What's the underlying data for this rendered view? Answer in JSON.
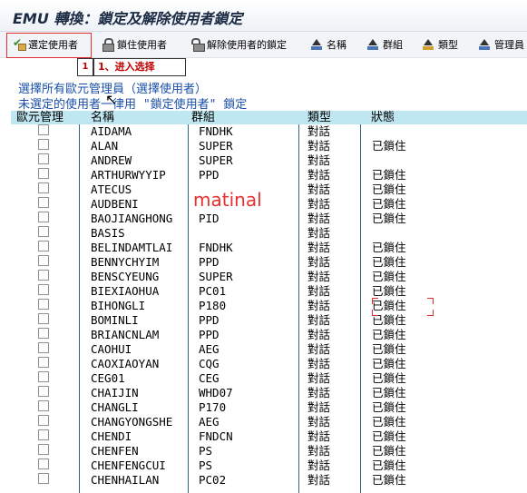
{
  "window": {
    "title": "EMU 轉換：鎖定及解除使用者鎖定"
  },
  "toolbar": {
    "select_users": "選定使用者",
    "lock_users": "鎖住使用者",
    "unlock_users": "解除使用者的鎖定",
    "name": "名稱",
    "group": "群組",
    "type": "類型",
    "admin": "管理員"
  },
  "callout": {
    "number": "1",
    "text": "1、进入选择"
  },
  "links": {
    "select_all_admins": "選擇所有歐元管理員（選擇使用者）",
    "unselected_lock": "未選定的使用者一律用 \"鎖定使用者\" 鎖定"
  },
  "watermark": "matinal",
  "table": {
    "headers": {
      "admin": "歐元管理",
      "name": "名稱",
      "group": "群組",
      "type": "類型",
      "status": "狀態"
    },
    "rows": [
      {
        "name": "AIDAMA",
        "group": "FNDHK",
        "type": "對話",
        "status": ""
      },
      {
        "name": "ALAN",
        "group": "SUPER",
        "type": "對話",
        "status": "已鎖住"
      },
      {
        "name": "ANDREW",
        "group": "SUPER",
        "type": "對話",
        "status": ""
      },
      {
        "name": "ARTHURWYYIP",
        "group": "PPD",
        "type": "對話",
        "status": "已鎖住"
      },
      {
        "name": "ATECUS",
        "group": "",
        "type": "對話",
        "status": "已鎖住"
      },
      {
        "name": "AUDBENI",
        "group": "",
        "type": "對話",
        "status": "已鎖住"
      },
      {
        "name": "BAOJIANGHONG",
        "group": "PID",
        "type": "對話",
        "status": "已鎖住"
      },
      {
        "name": "BASIS",
        "group": "",
        "type": "對話",
        "status": ""
      },
      {
        "name": "BELINDAMTLAI",
        "group": "FNDHK",
        "type": "對話",
        "status": "已鎖住"
      },
      {
        "name": "BENNYCHYIM",
        "group": "PPD",
        "type": "對話",
        "status": "已鎖住"
      },
      {
        "name": "BENSCYEUNG",
        "group": "SUPER",
        "type": "對話",
        "status": "已鎖住"
      },
      {
        "name": "BIEXIAOHUA",
        "group": "PC01",
        "type": "對話",
        "status": "已鎖住"
      },
      {
        "name": "BIHONGLI",
        "group": "P180",
        "type": "對話",
        "status": "已鎖住"
      },
      {
        "name": "BOMINLI",
        "group": "PPD",
        "type": "對話",
        "status": "已鎖住"
      },
      {
        "name": "BRIANCNLAM",
        "group": "PPD",
        "type": "對話",
        "status": "已鎖住"
      },
      {
        "name": "CAOHUI",
        "group": "AEG",
        "type": "對話",
        "status": "已鎖住"
      },
      {
        "name": "CAOXIAOYAN",
        "group": "CQG",
        "type": "對話",
        "status": "已鎖住"
      },
      {
        "name": "CEG01",
        "group": "CEG",
        "type": "對話",
        "status": "已鎖住"
      },
      {
        "name": "CHAIJIN",
        "group": "WHD07",
        "type": "對話",
        "status": "已鎖住"
      },
      {
        "name": "CHANGLI",
        "group": "P170",
        "type": "對話",
        "status": "已鎖住"
      },
      {
        "name": "CHANGYONGSHE",
        "group": "AEG",
        "type": "對話",
        "status": "已鎖住"
      },
      {
        "name": "CHENDI",
        "group": "FNDCN",
        "type": "對話",
        "status": "已鎖住"
      },
      {
        "name": "CHENFEN",
        "group": "PS",
        "type": "對話",
        "status": "已鎖住"
      },
      {
        "name": "CHENFENGCUI",
        "group": "PS",
        "type": "對話",
        "status": "已鎖住"
      },
      {
        "name": "CHENHAILAN",
        "group": "PC02",
        "type": "對話",
        "status": "已鎖住"
      }
    ]
  }
}
